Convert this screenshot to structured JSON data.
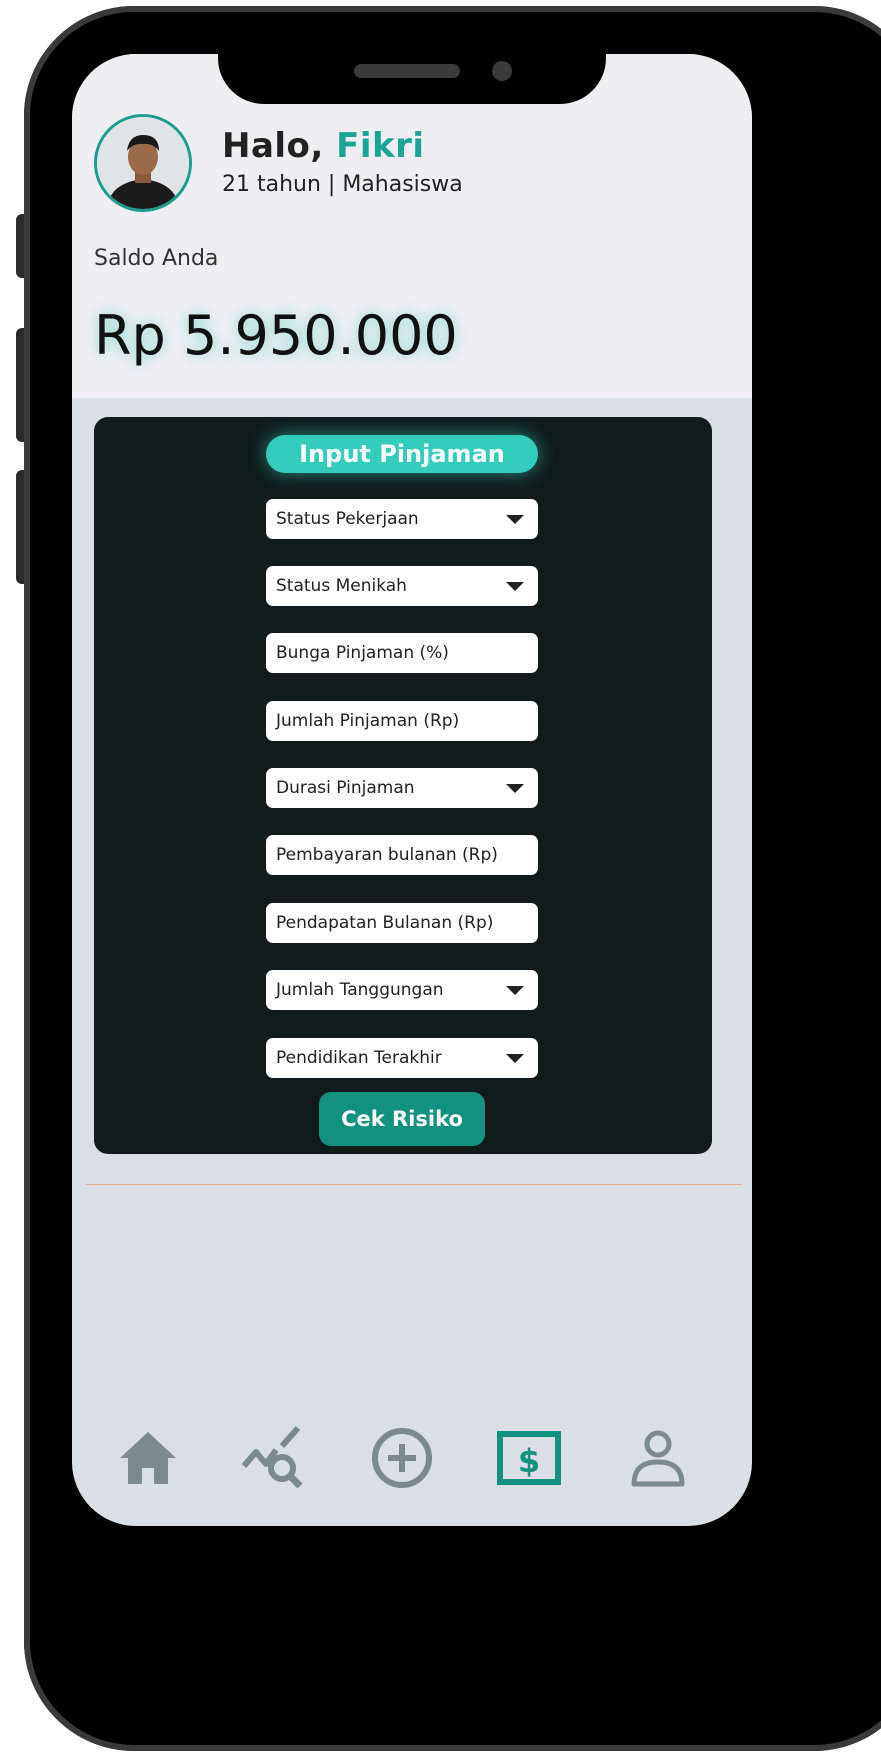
{
  "profile": {
    "greeting": "Halo,",
    "name": "Fikri",
    "subtitle": "21 tahun | Mahasiswa"
  },
  "balance": {
    "label": "Saldo Anda",
    "value": "Rp 5.950.000"
  },
  "form": {
    "title": "Input Pinjaman",
    "fields": [
      {
        "label": "Status Pekerjaan",
        "type": "select"
      },
      {
        "label": "Status Menikah",
        "type": "select"
      },
      {
        "label": "Bunga Pinjaman (%)",
        "type": "input"
      },
      {
        "label": "Jumlah Pinjaman (Rp)",
        "type": "input"
      },
      {
        "label": "Durasi Pinjaman",
        "type": "select"
      },
      {
        "label": "Pembayaran bulanan (Rp)",
        "type": "input"
      },
      {
        "label": "Pendapatan Bulanan (Rp)",
        "type": "input"
      },
      {
        "label": "Jumlah Tanggungan",
        "type": "select"
      },
      {
        "label": "Pendidikan Terakhir",
        "type": "select"
      }
    ],
    "submit_label": "Cek Risiko"
  },
  "nav": {
    "items": [
      "home-icon",
      "analytics-search-icon",
      "add-circle-icon",
      "money-icon",
      "profile-icon"
    ],
    "active": "money-icon"
  },
  "colors": {
    "accent": "#1aa595",
    "active_nav": "#12917f",
    "inactive_nav": "#7d8990",
    "card_bg": "#111b1b"
  }
}
